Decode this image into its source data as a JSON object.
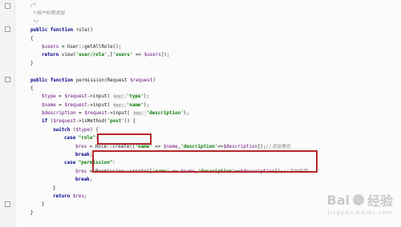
{
  "code_lines": [
    {
      "indent": 1,
      "tokens": [
        {
          "t": "/*",
          "c": "cmt"
        }
      ]
    },
    {
      "indent": 1,
      "tokens": [
        {
          "t": " *用户权限添加",
          "c": "cmt"
        }
      ]
    },
    {
      "indent": 1,
      "tokens": [
        {
          "t": " */",
          "c": "cmt"
        }
      ]
    },
    {
      "indent": 1,
      "tokens": [
        {
          "t": "public function ",
          "c": "kw"
        },
        {
          "t": "role()",
          "c": ""
        }
      ]
    },
    {
      "indent": 1,
      "tokens": [
        {
          "t": "{",
          "c": ""
        }
      ]
    },
    {
      "indent": 2,
      "tokens": [
        {
          "t": "$users",
          "c": "var"
        },
        {
          "t": " = User::getAllRole();",
          "c": ""
        }
      ]
    },
    {
      "indent": 2,
      "tokens": [
        {
          "t": "return ",
          "c": "kw"
        },
        {
          "t": "view(",
          "c": ""
        },
        {
          "t": "'user/role'",
          "c": "str"
        },
        {
          "t": ",[",
          "c": ""
        },
        {
          "t": "'users'",
          "c": "str"
        },
        {
          "t": " => ",
          "c": ""
        },
        {
          "t": "$users",
          "c": "var"
        },
        {
          "t": "]);",
          "c": ""
        }
      ]
    },
    {
      "indent": 1,
      "tokens": [
        {
          "t": "}",
          "c": ""
        }
      ]
    },
    {
      "indent": 0,
      "tokens": []
    },
    {
      "indent": 1,
      "tokens": [
        {
          "t": "public function ",
          "c": "kw"
        },
        {
          "t": "permission(Request ",
          "c": ""
        },
        {
          "t": "$request",
          "c": "var"
        },
        {
          "t": ")",
          "c": ""
        }
      ]
    },
    {
      "indent": 1,
      "tokens": [
        {
          "t": "{",
          "c": ""
        }
      ]
    },
    {
      "indent": 2,
      "tokens": [
        {
          "t": "$type",
          "c": "var"
        },
        {
          "t": " = ",
          "c": ""
        },
        {
          "t": "$request",
          "c": "var"
        },
        {
          "t": "->input( ",
          "c": ""
        },
        {
          "t": "key: ",
          "c": "hint"
        },
        {
          "t": "'type'",
          "c": "str"
        },
        {
          "t": ");",
          "c": ""
        }
      ]
    },
    {
      "indent": 2,
      "tokens": [
        {
          "t": "$name",
          "c": "var"
        },
        {
          "t": " = ",
          "c": ""
        },
        {
          "t": "$request",
          "c": "var"
        },
        {
          "t": "->input( ",
          "c": ""
        },
        {
          "t": "key: ",
          "c": "hint"
        },
        {
          "t": "'name'",
          "c": "str"
        },
        {
          "t": ");",
          "c": ""
        }
      ]
    },
    {
      "indent": 2,
      "tokens": [
        {
          "t": "$description",
          "c": "var"
        },
        {
          "t": " = ",
          "c": ""
        },
        {
          "t": "$request",
          "c": "var"
        },
        {
          "t": "->input( ",
          "c": ""
        },
        {
          "t": "key: ",
          "c": "hint"
        },
        {
          "t": "'description'",
          "c": "str"
        },
        {
          "t": ");",
          "c": ""
        }
      ]
    },
    {
      "indent": 2,
      "tokens": [
        {
          "t": "if ",
          "c": "kw"
        },
        {
          "t": "(",
          "c": ""
        },
        {
          "t": "$request",
          "c": "var"
        },
        {
          "t": "->isMethod(",
          "c": ""
        },
        {
          "t": "'post'",
          "c": "str"
        },
        {
          "t": ")) {",
          "c": ""
        }
      ]
    },
    {
      "indent": 3,
      "tokens": [
        {
          "t": "switch ",
          "c": "kw"
        },
        {
          "t": "(",
          "c": ""
        },
        {
          "t": "$type",
          "c": "var"
        },
        {
          "t": ") {",
          "c": ""
        }
      ]
    },
    {
      "indent": 4,
      "tokens": [
        {
          "t": "case ",
          "c": "kw"
        },
        {
          "t": "\"role\"",
          "c": "str"
        },
        {
          "t": ":",
          "c": ""
        }
      ]
    },
    {
      "indent": 5,
      "tokens": [
        {
          "t": "$res",
          "c": "var"
        },
        {
          "t": " = Role::create([",
          "c": ""
        },
        {
          "t": "'name'",
          "c": "str"
        },
        {
          "t": " => ",
          "c": ""
        },
        {
          "t": "$name",
          "c": "var"
        },
        {
          "t": ",",
          "c": ""
        },
        {
          "t": "'description'",
          "c": "str"
        },
        {
          "t": "=>",
          "c": ""
        },
        {
          "t": "$description",
          "c": "var"
        },
        {
          "t": "]);",
          "c": ""
        },
        {
          "t": "//添加角色",
          "c": "cmt"
        }
      ]
    },
    {
      "indent": 5,
      "tokens": [
        {
          "t": "break",
          "c": "kw"
        },
        {
          "t": ";",
          "c": ""
        }
      ]
    },
    {
      "indent": 4,
      "tokens": [
        {
          "t": "case ",
          "c": "kw"
        },
        {
          "t": "\"permission\"",
          "c": "str"
        },
        {
          "t": ":",
          "c": ""
        }
      ]
    },
    {
      "indent": 5,
      "tokens": [
        {
          "t": "$res",
          "c": "var"
        },
        {
          "t": " = Permission::create([",
          "c": ""
        },
        {
          "t": "'name'",
          "c": "str"
        },
        {
          "t": " => ",
          "c": ""
        },
        {
          "t": "$name",
          "c": "var"
        },
        {
          "t": ",",
          "c": ""
        },
        {
          "t": "'description'",
          "c": "str"
        },
        {
          "t": "=>",
          "c": ""
        },
        {
          "t": "$description",
          "c": "var"
        },
        {
          "t": "]);",
          "c": ""
        },
        {
          "t": "//添加权限",
          "c": "cmt"
        }
      ]
    },
    {
      "indent": 5,
      "tokens": [
        {
          "t": "break",
          "c": "kw"
        },
        {
          "t": ";",
          "c": ""
        }
      ]
    },
    {
      "indent": 3,
      "tokens": [
        {
          "t": "}",
          "c": ""
        }
      ]
    },
    {
      "indent": 3,
      "tokens": [
        {
          "t": "return ",
          "c": "kw"
        },
        {
          "t": "$res",
          "c": "var"
        },
        {
          "t": ";",
          "c": ""
        }
      ]
    },
    {
      "indent": 2,
      "tokens": [
        {
          "t": "}",
          "c": ""
        }
      ]
    },
    {
      "indent": 1,
      "tokens": [
        {
          "t": "}",
          "c": ""
        }
      ]
    }
  ],
  "watermark": {
    "brand": "Bai",
    "brand_cn": "经验",
    "sub": "jingyan.baidu.com"
  },
  "colors": {
    "highlight_box": "#b3262a",
    "keyword": "#00008b",
    "string": "#0b7a0b",
    "variable": "#660e7a",
    "comment": "#8a8a8a"
  }
}
